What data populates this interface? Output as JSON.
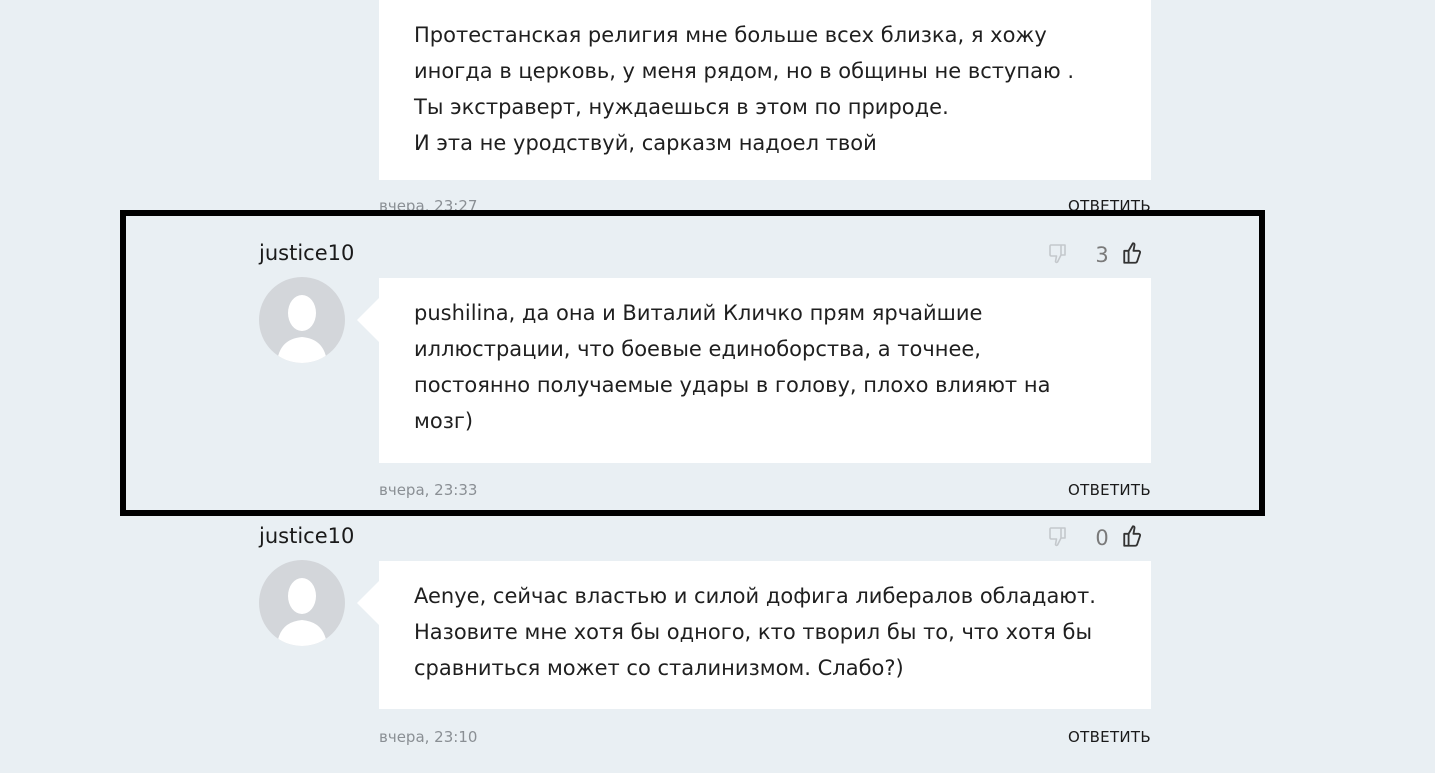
{
  "comments": [
    {
      "author": "",
      "text": "Протестанская религия мне больше всех близка, я хожу\nиногда в церковь, у меня рядом, но в общины не вступаю .\nТы экстраверт, нуждаешься в этом по природе.\nИ эта не уродствуй, сарказм надоел твой",
      "timestamp": "вчера, 23:27",
      "reply_label": "ОТВЕТИТЬ",
      "votes": ""
    },
    {
      "author": "justice10",
      "text": "pushilina, да она и Виталий Кличко прям ярчайшие\nиллюстрации, что боевые единоборства, а точнее,\nпостоянно получаемые удары в голову, плохо влияют на\nмозг)",
      "timestamp": "вчера, 23:33",
      "reply_label": "ОТВЕТИТЬ",
      "votes": "3"
    },
    {
      "author": "justice10",
      "text": "Aenye, сейчас властью и силой дофига либералов обладают.\nНазовите мне хотя бы одного, кто творил бы то, что хотя бы\nсравниться может со сталинизмом. Слабо?)",
      "timestamp": "вчера, 23:10",
      "reply_label": "ОТВЕТИТЬ",
      "votes": "0"
    }
  ],
  "icons": {
    "vote_down": "thumbs-down-icon",
    "vote_up": "thumbs-up-icon",
    "avatar": "default-user-avatar"
  },
  "colors": {
    "page_background": "#e9eff3",
    "bubble_background": "#ffffff",
    "timestamp": "#8a8f94",
    "vote_count": "#7a7a7a",
    "vote_up_icon": "#333333",
    "vote_down_icon": "#c4c8cc",
    "highlight_border": "#000000"
  }
}
